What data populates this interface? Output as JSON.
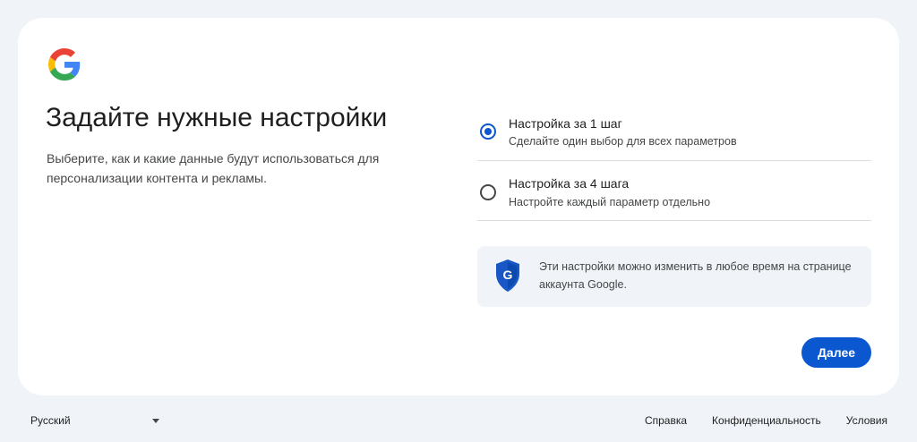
{
  "page": {
    "title": "Задайте нужные настройки",
    "subtitle": "Выберите, как и какие данные будут использоваться для персонализации контента и рекламы."
  },
  "options": [
    {
      "title": "Настройка за 1 шаг",
      "description": "Сделайте один выбор для всех параметров",
      "selected": true
    },
    {
      "title": "Настройка за 4 шага",
      "description": "Настройте каждый параметр отдельно",
      "selected": false
    }
  ],
  "info": {
    "icon": "google-shield-icon",
    "text": "Эти настройки можно изменить в любое время на странице аккаунта Google."
  },
  "actions": {
    "next_label": "Далее"
  },
  "footer": {
    "language": "Русский",
    "links": [
      "Справка",
      "Конфиденциальность",
      "Условия"
    ]
  },
  "colors": {
    "accent": "#0b57d0",
    "background": "#f0f4f9",
    "card": "#ffffff"
  }
}
